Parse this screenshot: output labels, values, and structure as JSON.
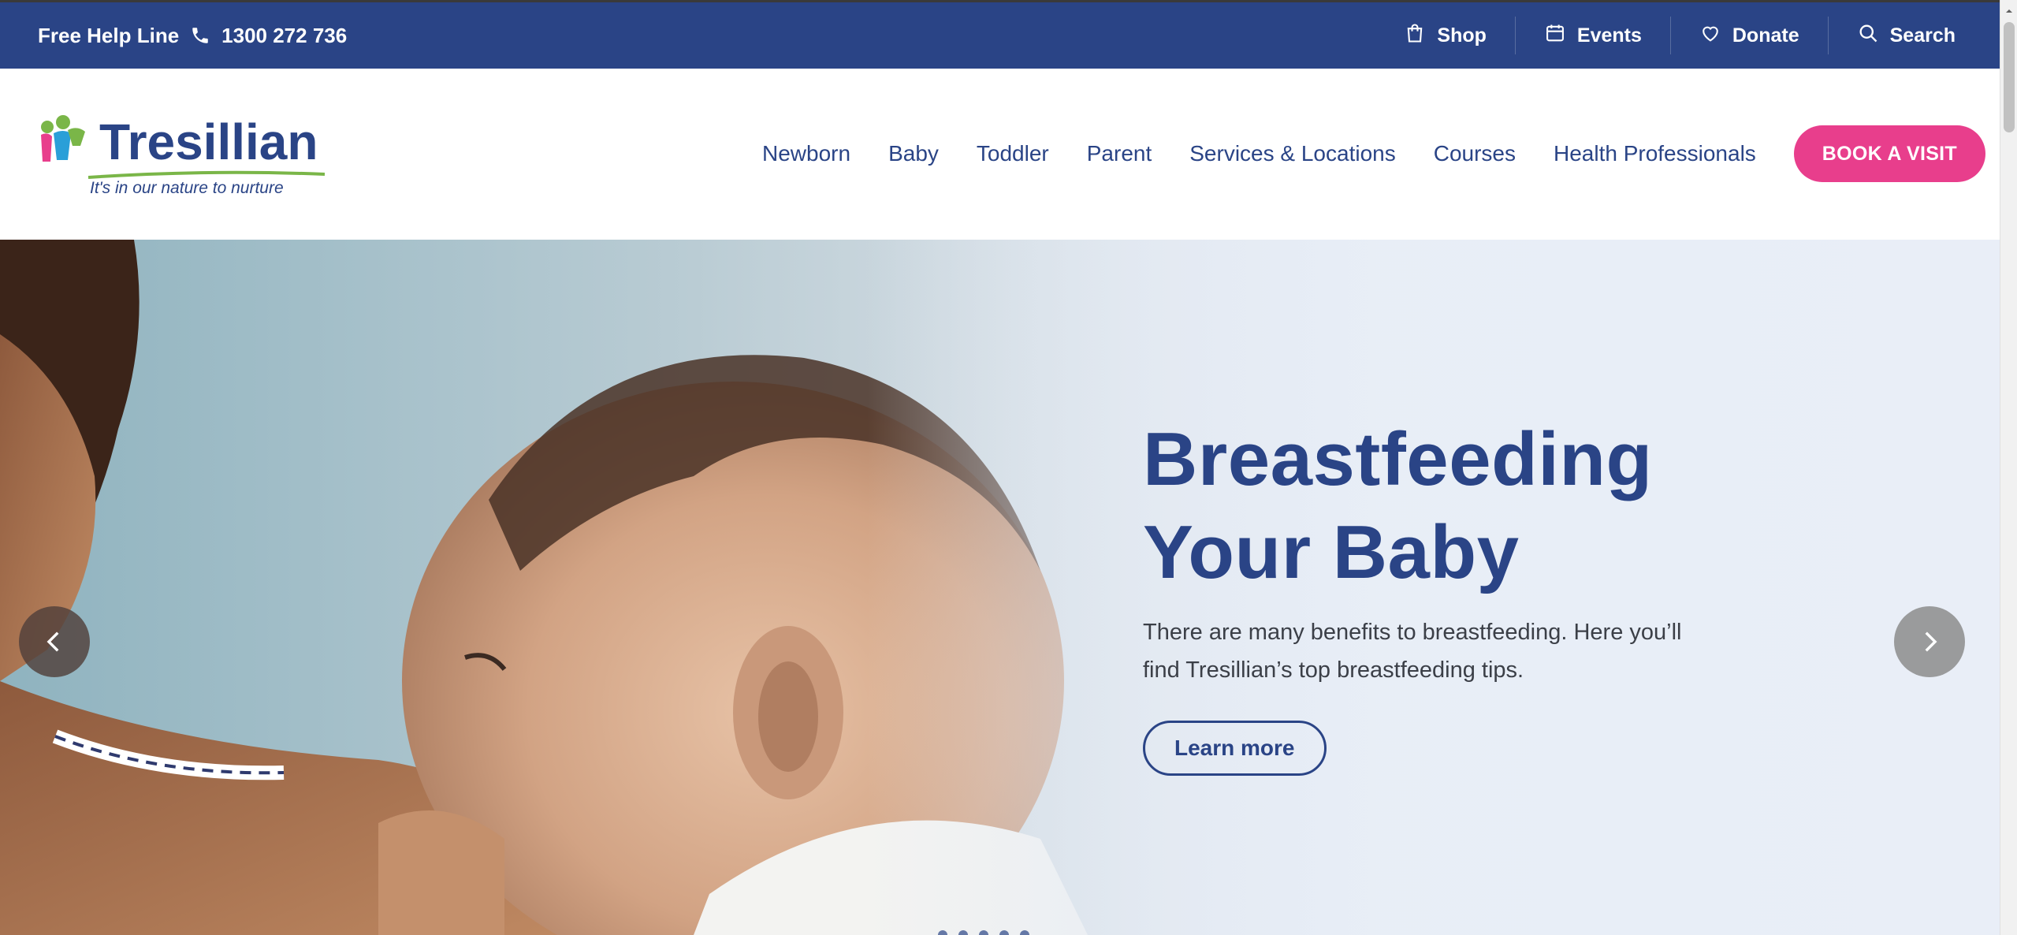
{
  "topbar": {
    "helpline_label": "Free Help Line",
    "phone_number": "1300 272 736",
    "items": [
      {
        "label": "Shop",
        "icon": "shopping-bag-icon"
      },
      {
        "label": "Events",
        "icon": "calendar-icon"
      },
      {
        "label": "Donate",
        "icon": "heart-icon"
      },
      {
        "label": "Search",
        "icon": "search-icon"
      }
    ]
  },
  "header": {
    "logo": {
      "word": "Tresillian",
      "tagline": "It's in our nature to nurture"
    },
    "nav": [
      "Newborn",
      "Baby",
      "Toddler",
      "Parent",
      "Services & Locations",
      "Courses",
      "Health Professionals"
    ],
    "cta_label": "BOOK A VISIT"
  },
  "hero": {
    "title_line1": "Breastfeeding",
    "title_line2": "Your Baby",
    "text": "There are many benefits to breastfeeding. Here you’ll find Tresillian’s top breastfeeding tips.",
    "button_label": "Learn more",
    "slide_count": 5
  },
  "colors": {
    "brand_navy": "#2a4486",
    "accent_pink": "#e83e8c",
    "logo_green": "#7ab648"
  }
}
